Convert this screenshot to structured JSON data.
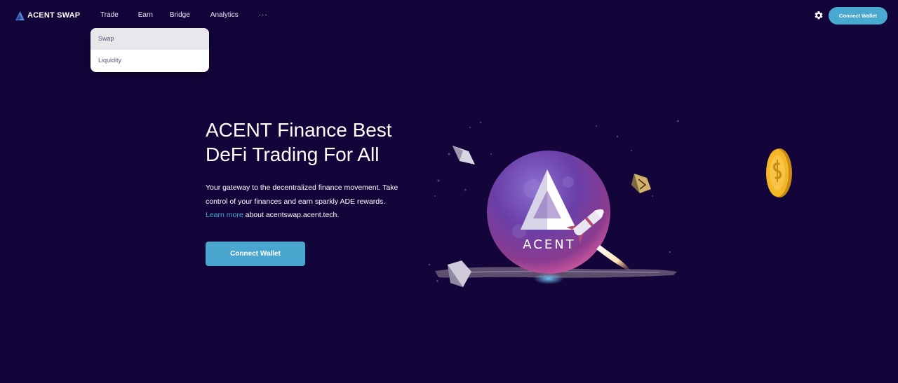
{
  "brand": {
    "name": "ACENT SWAP",
    "logo_icon": "acent-triangle-logo-icon"
  },
  "nav": {
    "items": [
      {
        "label": "Trade"
      },
      {
        "label": "Earn"
      },
      {
        "label": "Bridge"
      },
      {
        "label": "Analytics"
      }
    ],
    "more_label": "···",
    "dropdown": {
      "items": [
        {
          "label": "Swap",
          "active": true
        },
        {
          "label": "Liquidity",
          "active": false
        }
      ]
    }
  },
  "header": {
    "settings_icon": "gear-icon",
    "connect_label": "Connect Wallet"
  },
  "hero": {
    "title_line1": "ACENT Finance Best",
    "title_line2": "DeFi Trading For All",
    "desc_line1": "Your gateway to the decentralized finance movement. Take",
    "desc_line2": "control of your finances and earn sparkly ADE rewards.",
    "learn_more": "Learn more",
    "desc_tail": " about acentswap.acent.tech.",
    "connect_label": "Connect Wallet"
  },
  "illustration": {
    "planet_label": "ACENT",
    "icons": [
      "acent-planet-icon",
      "rocket-icon",
      "crystal-gem-icon",
      "coin-icon"
    ]
  },
  "colors": {
    "background": "#13043a",
    "accent": "#4aa9d1",
    "dropdown_bg": "#ffffff",
    "dropdown_active": "#e8e7ec"
  }
}
